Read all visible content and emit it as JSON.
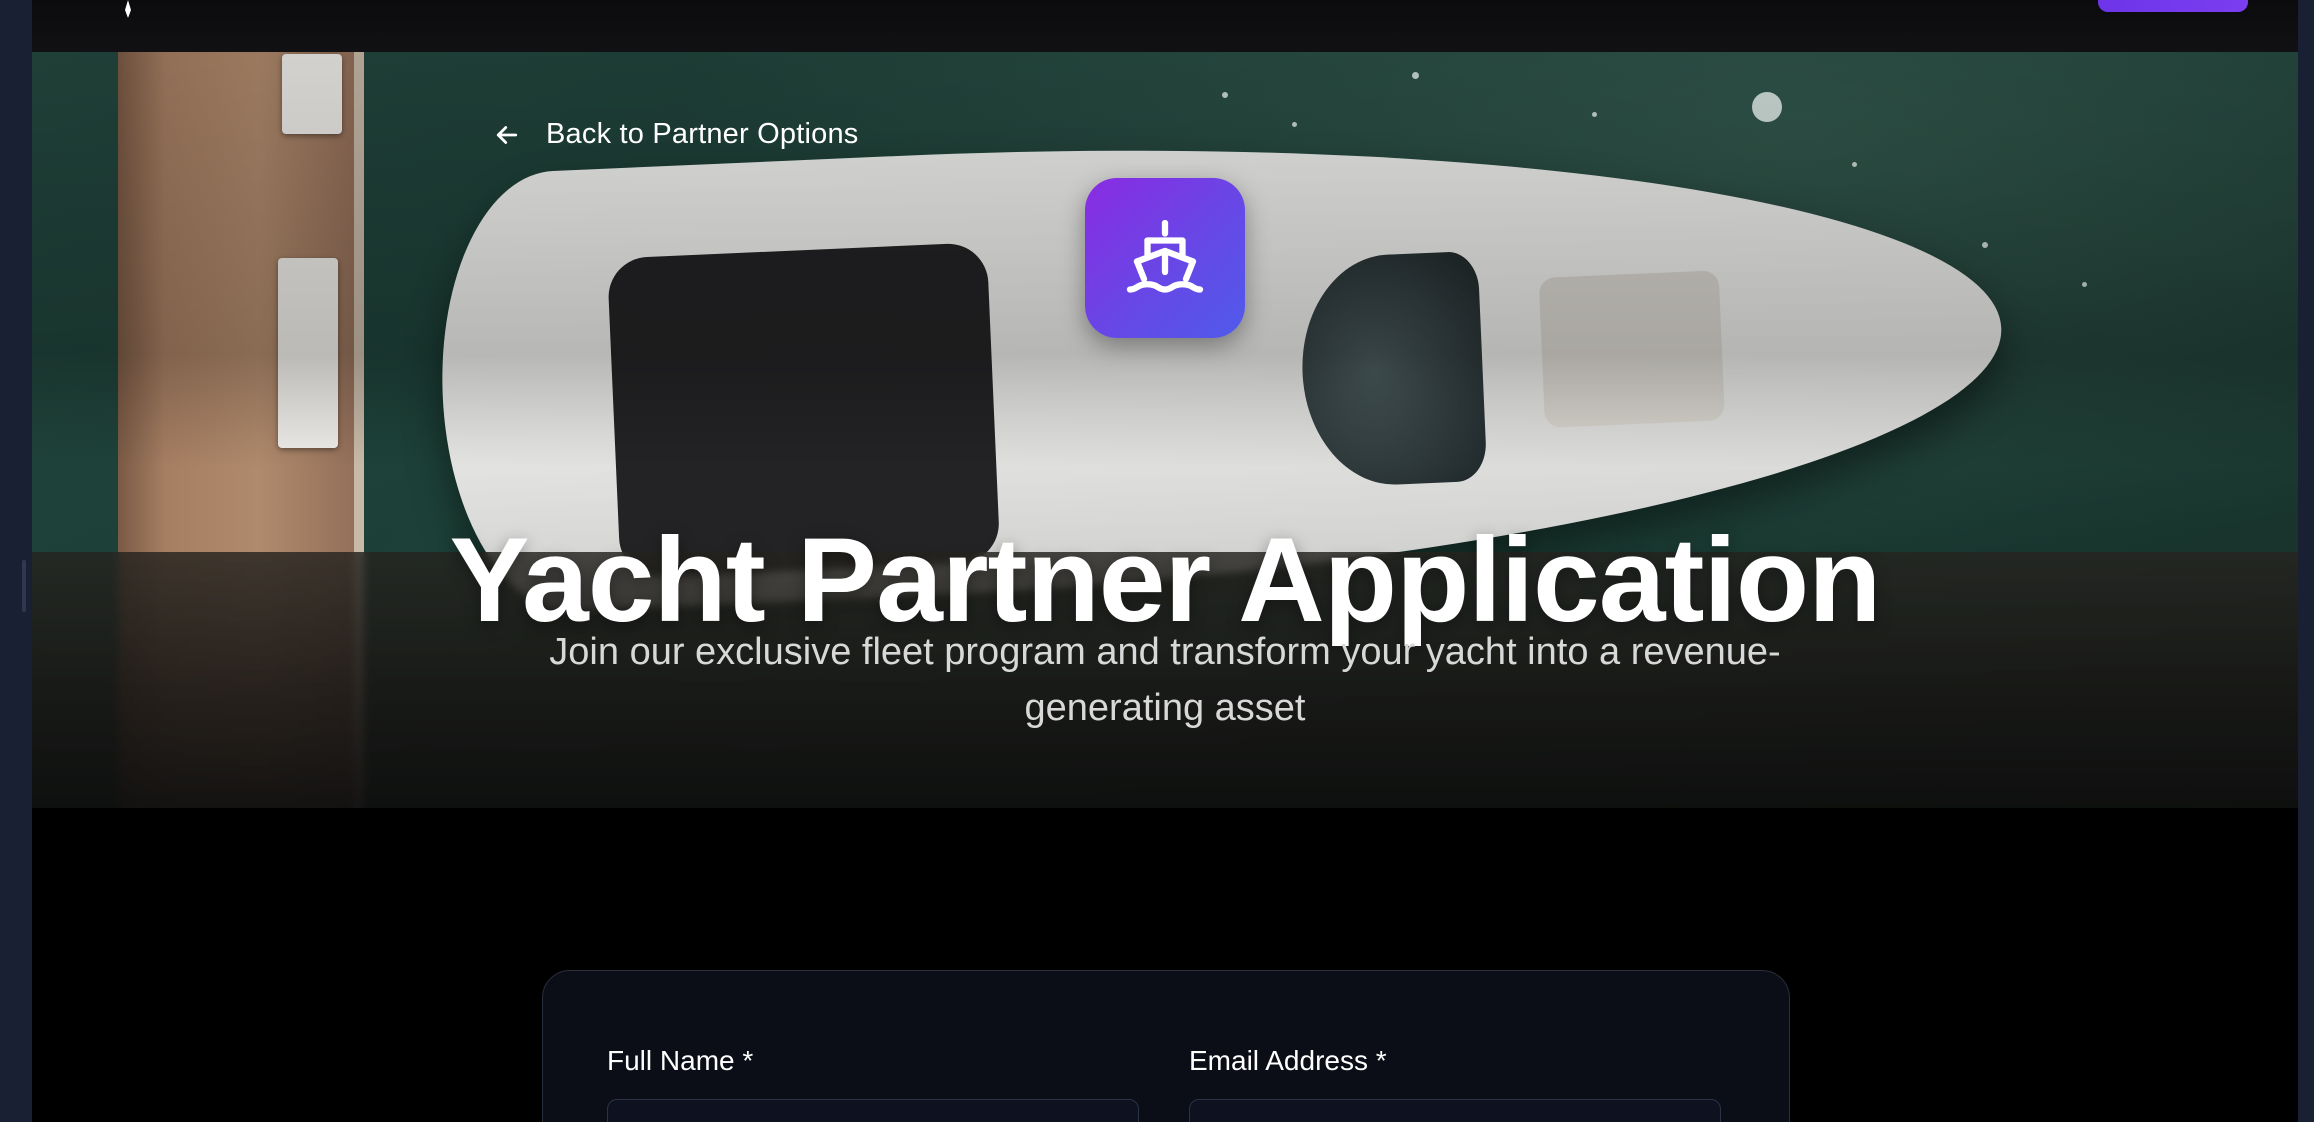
{
  "header": {
    "logo_icon": "compass-needle-icon",
    "cta_color": "#7b3ef0"
  },
  "hero": {
    "back_link_label": "Back to Partner Options",
    "back_icon": "arrow-left-icon",
    "app_icon": "ship-icon",
    "app_icon_gradient": [
      "#8a2be2",
      "#4f5bea"
    ],
    "title": "Yacht Partner Application",
    "subtitle": "Join our exclusive fleet program and transform your yacht into a revenue-generating asset"
  },
  "form": {
    "full_name_label": "Full Name *",
    "email_label": "Email Address *",
    "full_name_value": "",
    "email_value": ""
  }
}
